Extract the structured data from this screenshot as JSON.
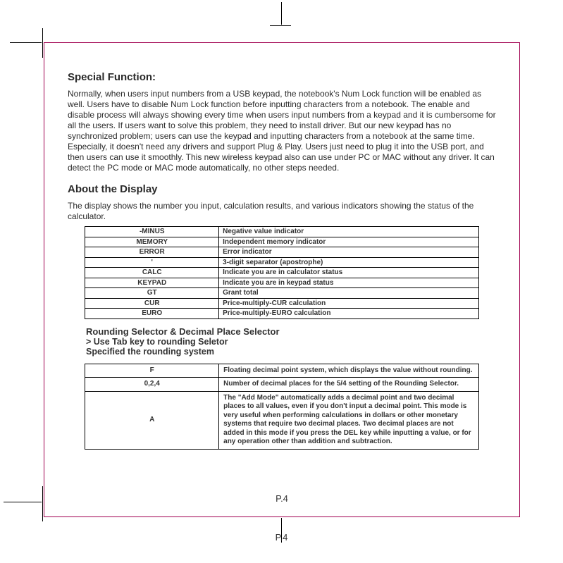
{
  "special": {
    "heading": "Special Function:",
    "body": "Normally, when users input numbers from a USB keypad, the notebook's Num Lock function will be enabled as well. Users have to disable Num Lock function before inputting characters from a notebook. The enable and disable process will always showing every time when users input numbers from a keypad and it is cumbersome for all the users. If users want to solve this problem, they need to install driver. But our new keypad has no synchronized problem; users can use the keypad and inputting characters from a notebook at the same time. Especially, it doesn't need any drivers and support Plug & Play. Users just need to plug it into the USB port, and then users can use it smoothly. This new wireless keypad also can use under PC or MAC without any driver. It can detect the PC mode or MAC mode automatically, no other steps needed."
  },
  "about": {
    "heading": "About the Display",
    "body": "The display shows the number you input, calculation results, and various indicators showing the status of the calculator."
  },
  "indicators": [
    {
      "k": "-MINUS",
      "v": "Negative value indicator"
    },
    {
      "k": "MEMORY",
      "v": "Independent memory indicator"
    },
    {
      "k": "ERROR",
      "v": "Error indicator"
    },
    {
      "k": "'",
      "v": "3-digit separator (apostrophe)"
    },
    {
      "k": "CALC",
      "v": "Indicate you are in calculator status"
    },
    {
      "k": "KEYPAD",
      "v": "Indicate you are in keypad status"
    },
    {
      "k": "GT",
      "v": "Grant total"
    },
    {
      "k": "CUR",
      "v": "Price-multiply-CUR calculation"
    },
    {
      "k": "EURO",
      "v": "Price-multiply-EURO calculation"
    }
  ],
  "rounding": {
    "title": "Rounding Selector & Decimal Place Selector",
    "line1": ">  Use Tab key to rounding Seletor",
    "line2": "Specified the rounding system"
  },
  "rounding_rows": [
    {
      "k": "F",
      "v": "Floating decimal point system, which displays the value without rounding."
    },
    {
      "k": "0,2,4",
      "v": "Number of decimal places for the 5/4 setting of the Rounding Selector."
    },
    {
      "k": "A",
      "v": "The \"Add Mode\" automatically adds a decimal point and two decimal places to all values, even if you don't input a decimal point. This mode is very useful when performing calculations in dollars or other monetary systems that require two decimal places. Two decimal places are not added in this mode if you press the DEL key while inputting a value, or for any operation other than addition and subtraction."
    }
  ],
  "page_number": "P.4"
}
